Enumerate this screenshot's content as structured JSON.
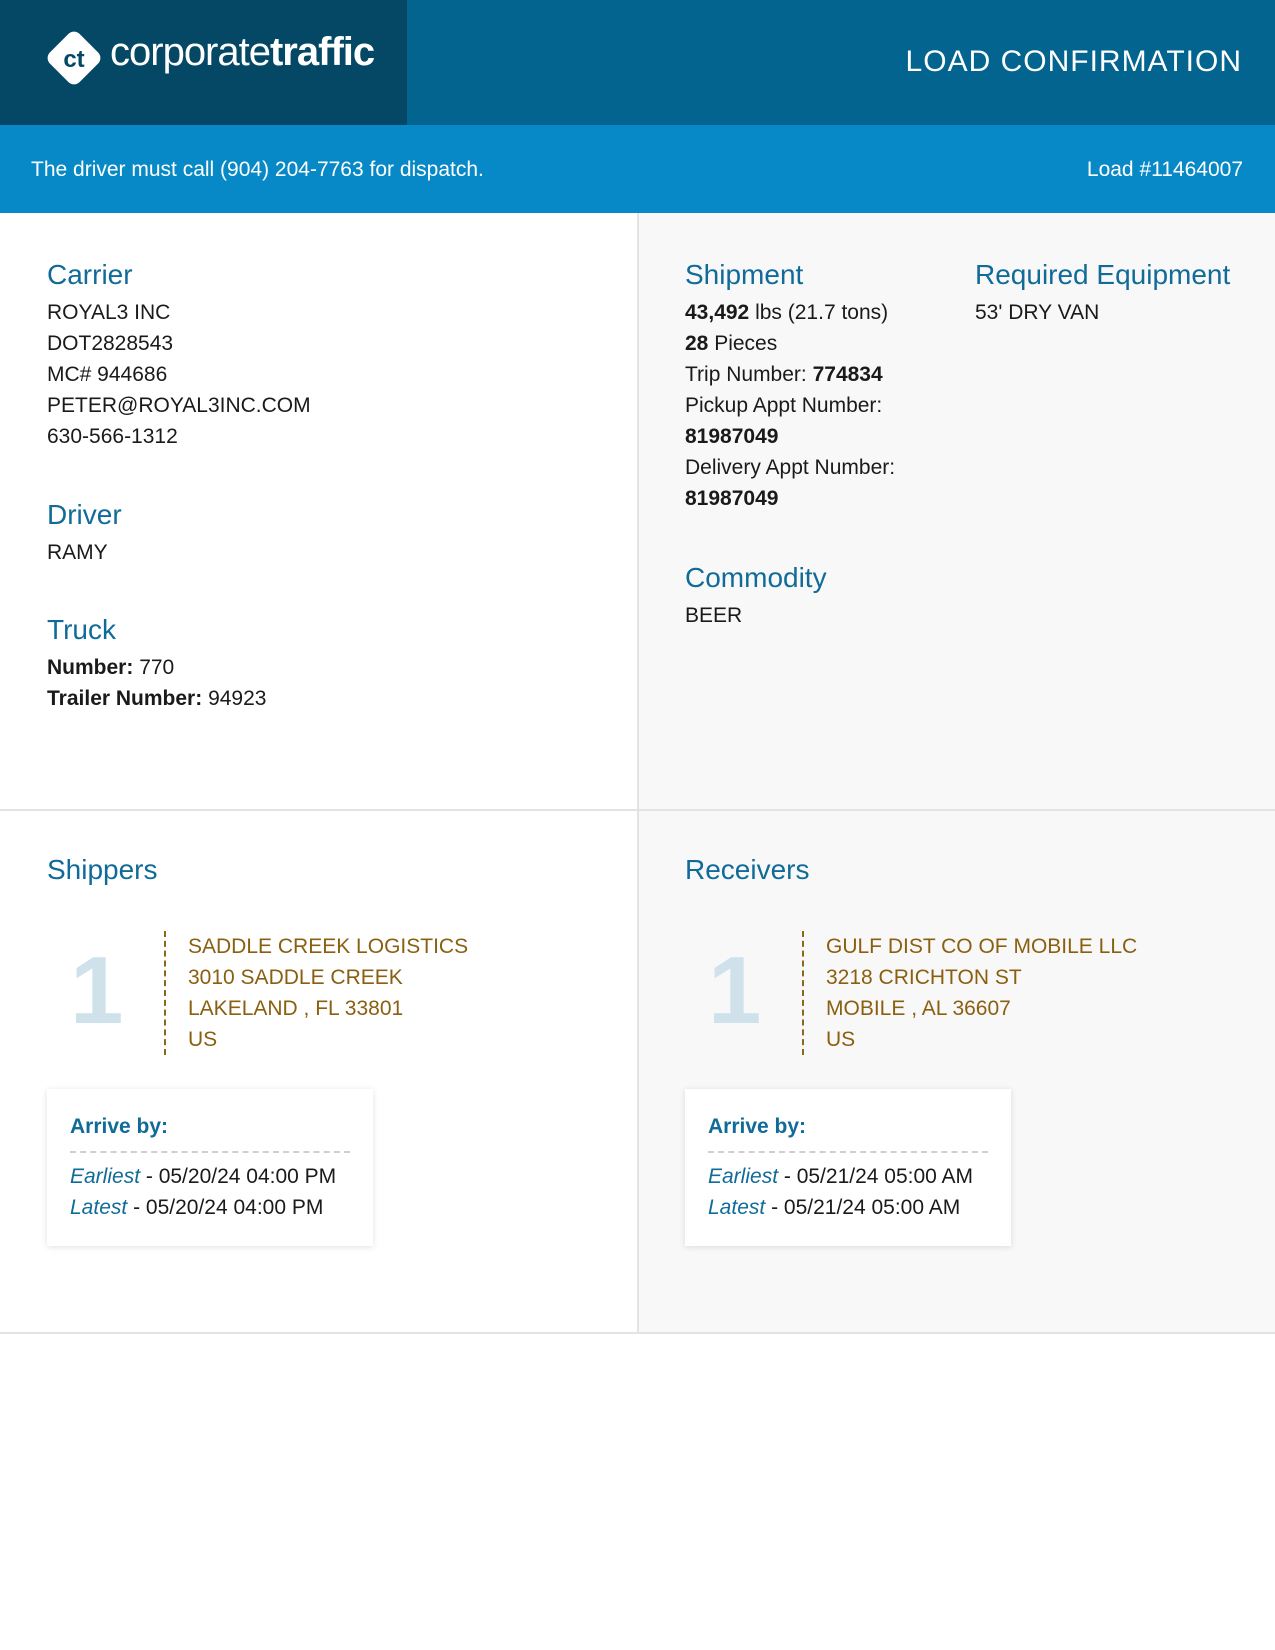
{
  "header": {
    "logo_prefix": "corporate",
    "logo_suffix": "traffic",
    "title": "LOAD CONFIRMATION"
  },
  "subbar": {
    "dispatch": "The driver must call (904) 204-7763 for dispatch.",
    "load": "Load #11464007"
  },
  "carrier": {
    "title": "Carrier",
    "name": "ROYAL3 INC",
    "dot": "DOT2828543",
    "mc": "MC# 944686",
    "email": "PETER@ROYAL3INC.COM",
    "phone": "630-566-1312"
  },
  "driver": {
    "title": "Driver",
    "name": "RAMY"
  },
  "truck": {
    "title": "Truck",
    "number_label": "Number:",
    "number": "770",
    "trailer_label": "Trailer Number:",
    "trailer": "94923"
  },
  "shipment": {
    "title": "Shipment",
    "weight": "43,492",
    "weight_unit": "lbs (21.7 tons)",
    "pieces": "28",
    "pieces_label": "Pieces",
    "trip_label": "Trip Number:",
    "trip": "774834",
    "pickup_label": "Pickup Appt Number:",
    "pickup": "81987049",
    "delivery_label": "Delivery Appt Number:",
    "delivery": "81987049"
  },
  "equipment": {
    "title": "Required Equipment",
    "value": "53' DRY VAN"
  },
  "commodity": {
    "title": "Commodity",
    "value": "BEER"
  },
  "shippers": {
    "title": "Shippers",
    "stop_number": "1",
    "name": "SADDLE CREEK LOGISTICS",
    "address": "3010 SADDLE CREEK",
    "city": "LAKELAND , FL 33801",
    "country": "US",
    "arrive_title": "Arrive by:",
    "earliest_label": "Earliest",
    "earliest": "- 05/20/24 04:00 PM",
    "latest_label": "Latest",
    "latest": "- 05/20/24 04:00 PM"
  },
  "receivers": {
    "title": "Receivers",
    "stop_number": "1",
    "name": "GULF DIST CO OF MOBILE LLC",
    "address": "3218 CRICHTON ST",
    "city": "MOBILE , AL 36607",
    "country": "US",
    "arrive_title": "Arrive by:",
    "earliest_label": "Earliest",
    "earliest": "- 05/21/24 05:00 AM",
    "latest_label": "Latest",
    "latest": "- 05/21/24 05:00 AM"
  }
}
